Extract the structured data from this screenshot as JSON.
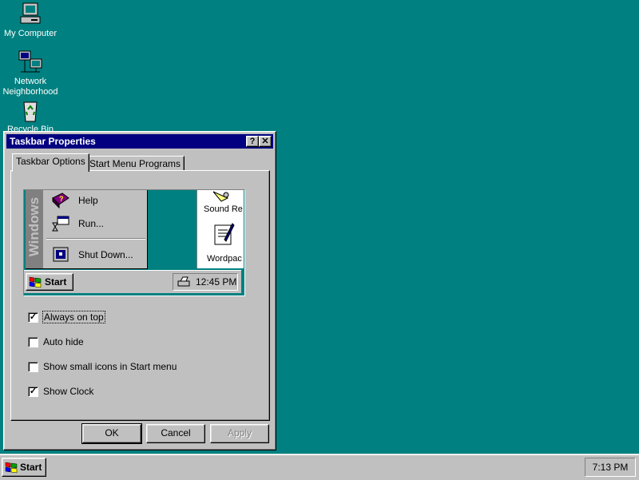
{
  "desktop": {
    "icons": [
      {
        "label": "My Computer",
        "icon": "my-computer-icon"
      },
      {
        "label": "Network\nNeighborhood",
        "icon": "network-neighborhood-icon"
      },
      {
        "label": "Recycle Bin",
        "icon": "recycle-bin-icon"
      }
    ]
  },
  "dialog": {
    "title": "Taskbar Properties",
    "help_button": "?",
    "close_button": "✕",
    "tabs": [
      {
        "label": "Taskbar Options",
        "active": true
      },
      {
        "label": "Start Menu Programs",
        "active": false
      }
    ],
    "preview": {
      "side_banner": "Windows",
      "menu_items": [
        {
          "label": "Help",
          "icon": "help-book-icon"
        },
        {
          "label": "Run...",
          "icon": "run-icon"
        },
        {
          "label": "Shut Down...",
          "icon": "shut-down-icon"
        }
      ],
      "window_items": [
        {
          "label": "Sound Re",
          "icon": "sound-recorder-icon"
        },
        {
          "label": "Wordpac",
          "icon": "wordpad-icon"
        }
      ],
      "start_label": "Start",
      "clock": "12:45 PM"
    },
    "options": [
      {
        "label": "Always on top",
        "checked": true
      },
      {
        "label": "Auto hide",
        "checked": false
      },
      {
        "label": "Show small icons in Start menu",
        "checked": false
      },
      {
        "label": "Show Clock",
        "checked": true
      }
    ],
    "buttons": {
      "ok": "OK",
      "cancel": "Cancel",
      "apply": "Apply"
    }
  },
  "taskbar": {
    "start_label": "Start",
    "clock": "7:13 PM"
  },
  "colors": {
    "desktop": "#008080",
    "title_active": "#000080",
    "face": "#c0c0c0"
  }
}
